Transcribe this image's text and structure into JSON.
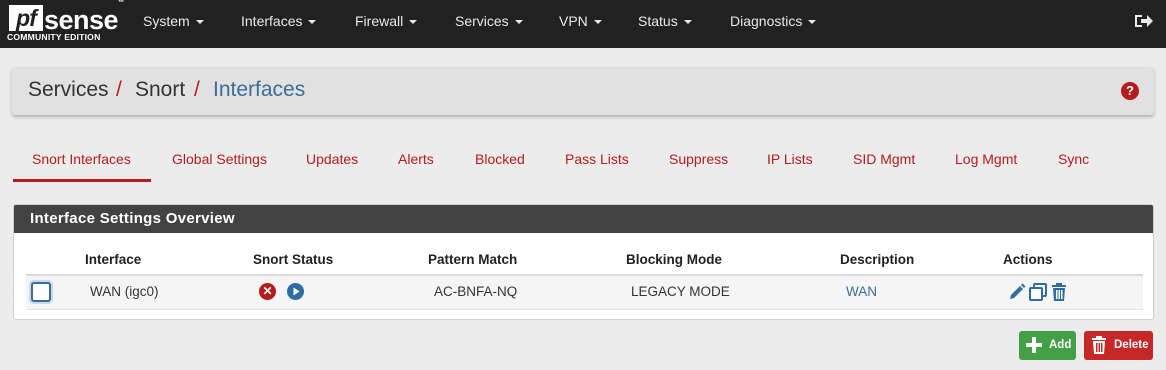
{
  "brand": {
    "logo_pf": "pf",
    "logo_sense": "sense",
    "logo_edition": "COMMUNITY EDITION"
  },
  "nav": {
    "items": [
      {
        "label": "System"
      },
      {
        "label": "Interfaces"
      },
      {
        "label": "Firewall"
      },
      {
        "label": "Services"
      },
      {
        "label": "VPN"
      },
      {
        "label": "Status"
      },
      {
        "label": "Diagnostics"
      }
    ],
    "logout_icon": "sign-out-icon"
  },
  "breadcrumb": {
    "part1": "Services",
    "part2": "Snort",
    "part3": "Interfaces",
    "separator": "/"
  },
  "tabs": [
    {
      "label": "Snort Interfaces",
      "active": true
    },
    {
      "label": "Global Settings"
    },
    {
      "label": "Updates"
    },
    {
      "label": "Alerts"
    },
    {
      "label": "Blocked"
    },
    {
      "label": "Pass Lists"
    },
    {
      "label": "Suppress"
    },
    {
      "label": "IP Lists"
    },
    {
      "label": "SID Mgmt"
    },
    {
      "label": "Log Mgmt"
    },
    {
      "label": "Sync"
    }
  ],
  "panel": {
    "title": "Interface Settings Overview",
    "columns": [
      "Interface",
      "Snort Status",
      "Pattern Match",
      "Blocking Mode",
      "Description",
      "Actions"
    ],
    "rows": [
      {
        "interface": "WAN (igc0)",
        "pattern_match": "AC-BNFA-NQ",
        "blocking_mode": "LEGACY MODE",
        "description": "WAN"
      }
    ]
  },
  "buttons": {
    "add": "Add",
    "delete": "Delete"
  },
  "colors": {
    "accent": "#b71c1c",
    "link": "#3a6d99",
    "navbar": "#212121",
    "add": "#43a047",
    "delete": "#c62828"
  }
}
